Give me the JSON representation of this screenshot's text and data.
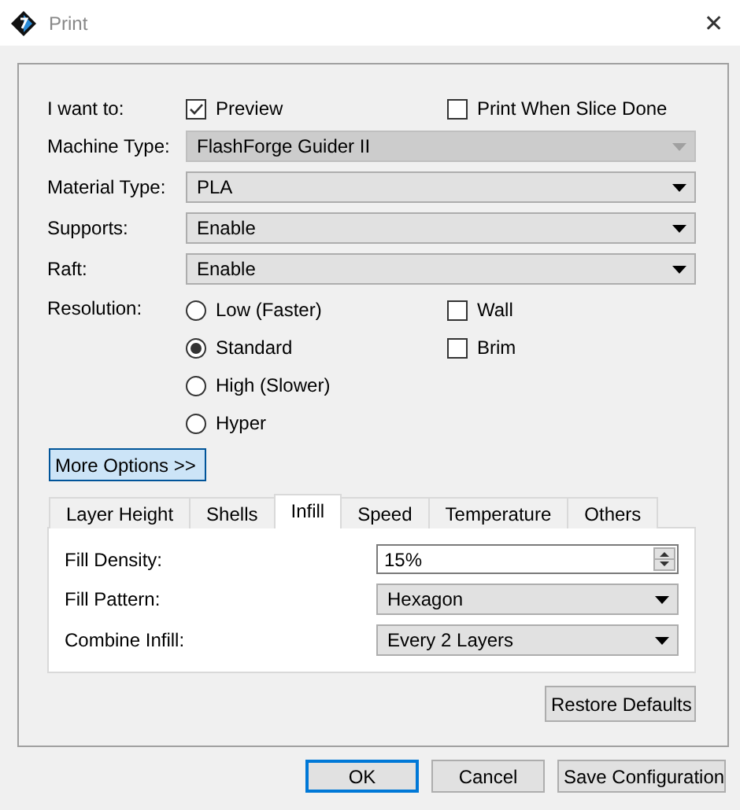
{
  "window": {
    "title": "Print",
    "close": "✕"
  },
  "i_want_to": {
    "label": "I want to:",
    "options": [
      {
        "label": "Preview",
        "checked": true
      },
      {
        "label": "Print When Slice Done",
        "checked": false
      }
    ]
  },
  "fields": [
    {
      "label": "Machine Type:",
      "value": "FlashForge Guider II",
      "disabled": true
    },
    {
      "label": "Material Type:",
      "value": "PLA",
      "disabled": false
    },
    {
      "label": "Supports:",
      "value": "Enable",
      "disabled": false
    },
    {
      "label": "Raft:",
      "value": "Enable",
      "disabled": false
    }
  ],
  "resolution": {
    "label": "Resolution:",
    "options": [
      {
        "label": "Low (Faster)",
        "selected": false
      },
      {
        "label": "Standard",
        "selected": true
      },
      {
        "label": "High (Slower)",
        "selected": false
      },
      {
        "label": "Hyper",
        "selected": false
      }
    ]
  },
  "extras": [
    {
      "label": "Wall",
      "checked": false
    },
    {
      "label": "Brim",
      "checked": false
    }
  ],
  "more_options_button": {
    "label": "More Options >>",
    "focused": true
  },
  "tabs": [
    {
      "label": "Layer Height",
      "selected": false
    },
    {
      "label": "Shells",
      "selected": false
    },
    {
      "label": "Infill",
      "selected": true
    },
    {
      "label": "Speed",
      "selected": false
    },
    {
      "label": "Temperature",
      "selected": false
    },
    {
      "label": "Others",
      "selected": false
    }
  ],
  "infill": [
    {
      "kind": "spin",
      "label": "Fill Density:",
      "value": "15%"
    },
    {
      "kind": "select",
      "label": "Fill Pattern:",
      "value": "Hexagon"
    },
    {
      "kind": "select",
      "label": "Combine Infill:",
      "value": "Every 2 Layers"
    }
  ],
  "restore_button": {
    "label": "Restore Defaults"
  },
  "buttons": [
    {
      "label": "OK",
      "focused": true
    },
    {
      "label": "Cancel",
      "focused": false
    },
    {
      "label": "Save Configuration",
      "focused": false
    }
  ]
}
